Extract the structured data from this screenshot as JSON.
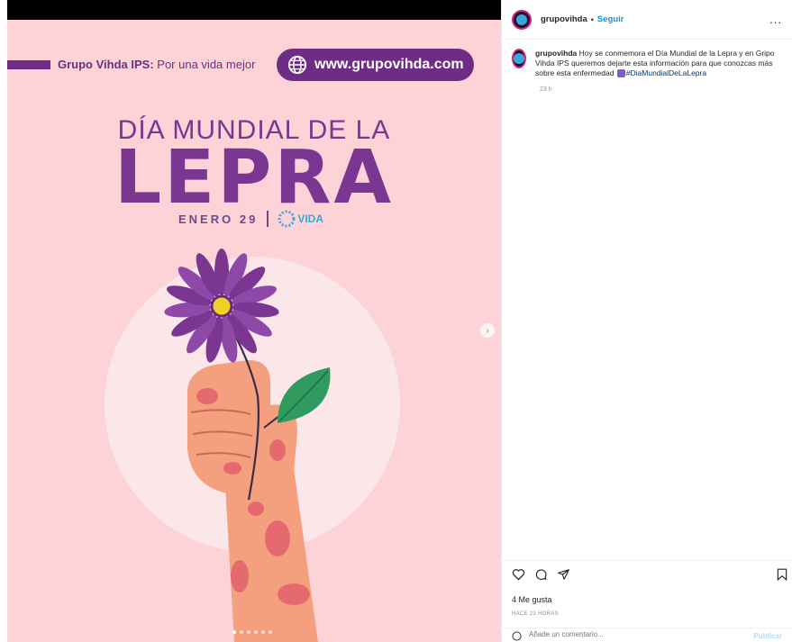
{
  "post": {
    "brand_bold": "Grupo Vihda IPS:",
    "brand_tagline": " Por una vida mejor",
    "url": "www.grupovihda.com",
    "title_line1": "DÍA MUNDIAL DE LA",
    "title_line2": "LEPRA",
    "date": "ENERO 29",
    "logo_text": "VIDA",
    "carousel_count": 6,
    "colors": {
      "background": "#fdd3d8",
      "purple": "#6f2c85",
      "petal": "#7b3692",
      "leaf": "#2f9b5f",
      "skin": "#f4a07e",
      "patch": "#e56a70"
    }
  },
  "panel": {
    "header": {
      "username": "grupovihda",
      "separator": "•",
      "follow_label": "Seguir",
      "more_icon": "more-horizontal-icon",
      "more_label": "..."
    },
    "caption": {
      "username": "grupovihda",
      "text": " Hoy se conmemora el Día Mundial de la Lepra y en Gripo Vihda IPS queremos dejarte esta información para que conozcas más sobre esta enfermedad ",
      "hashtag": "#DiaMundialDeLaLepra",
      "time": "23 h"
    },
    "actions": {
      "like_icon": "heart-icon",
      "comment_icon": "comment-icon",
      "share_icon": "send-icon",
      "save_icon": "bookmark-icon"
    },
    "likes": "4 Me gusta",
    "timestamp": "HACE 23 HORAS",
    "comment": {
      "placeholder": "Añade un comentario...",
      "publish_label": "Publicar"
    }
  }
}
